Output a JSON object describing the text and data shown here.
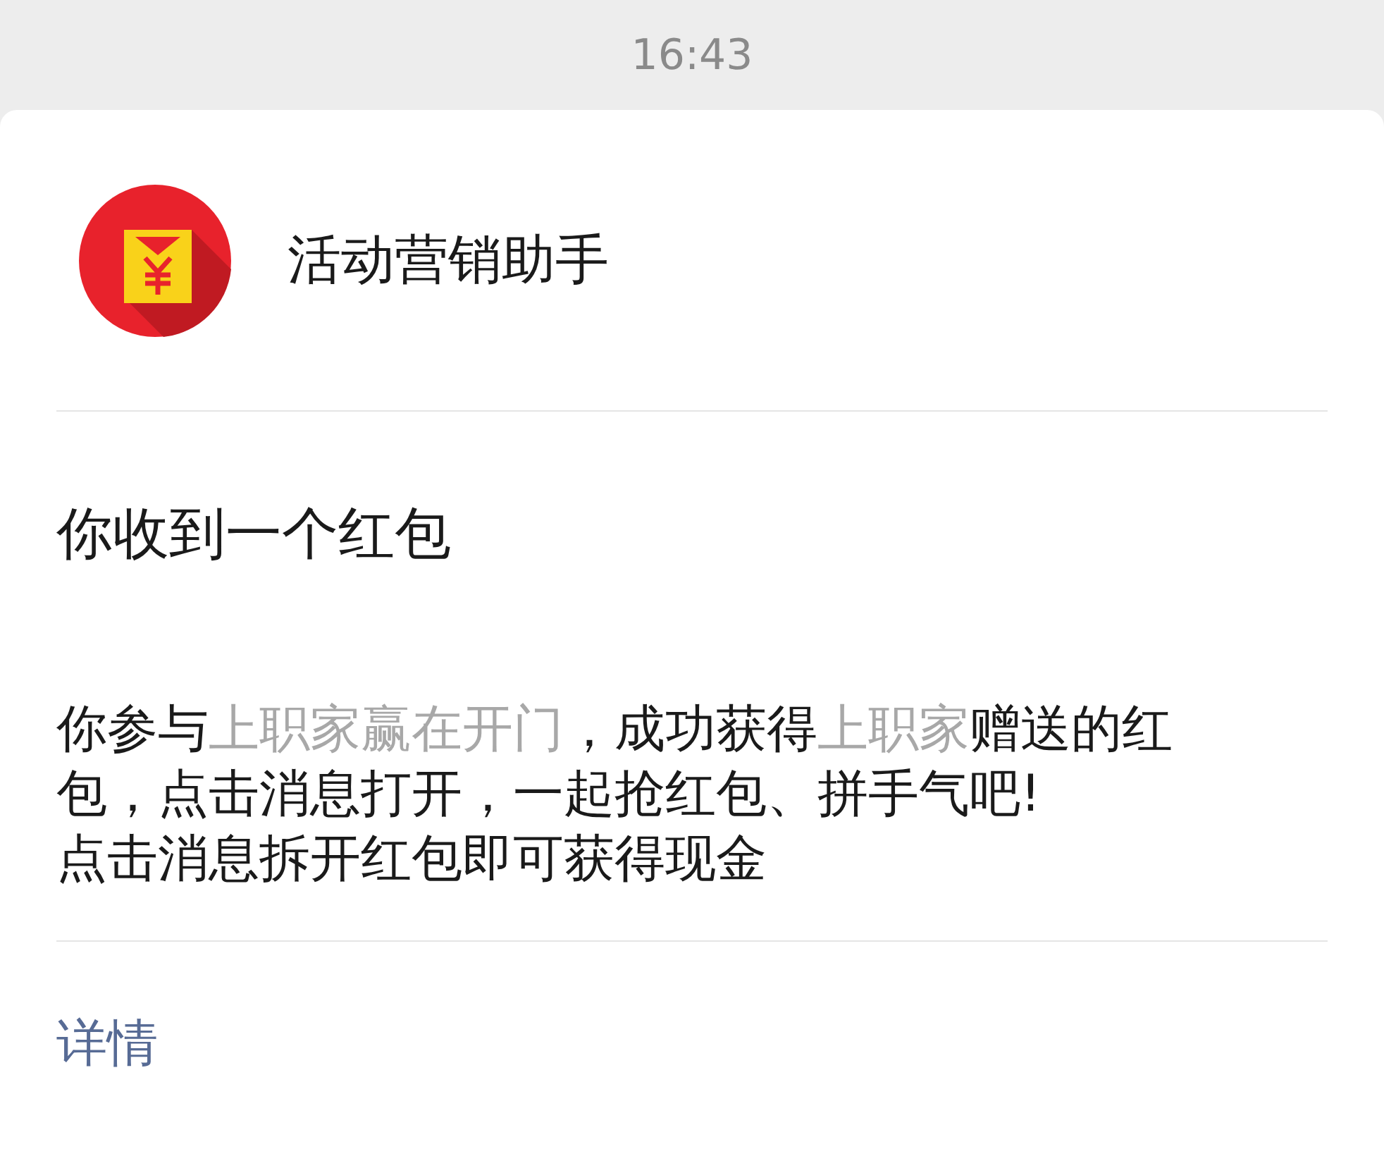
{
  "status_bar": {
    "time": "16:43"
  },
  "card": {
    "sender": "活动营销助手",
    "title": "你收到一个红包",
    "message": [
      {
        "kind": "plain",
        "text": "你参与"
      },
      {
        "kind": "highlight",
        "text": "上职家赢在开门"
      },
      {
        "kind": "plain",
        "text": "，成功获得"
      },
      {
        "kind": "highlight",
        "text": "上职家"
      },
      {
        "kind": "plain",
        "text": "赠送的红包，点击消息打开，一起抢红包、拼手气吧!"
      }
    ],
    "note": "点击消息拆开红包即可获得现金",
    "details_link": "详情"
  }
}
